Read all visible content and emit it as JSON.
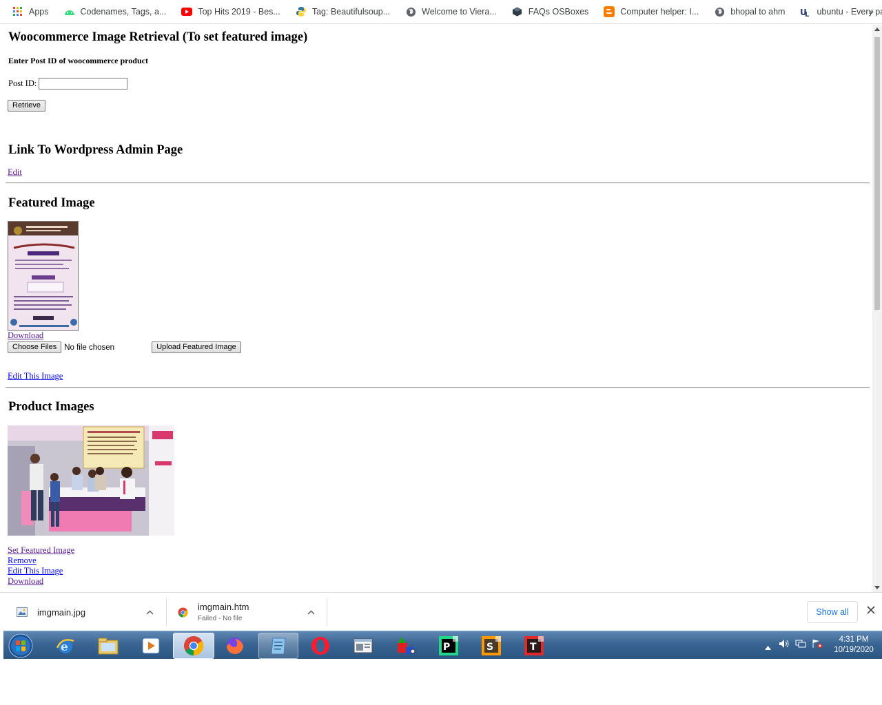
{
  "bookmarks": [
    {
      "label": "Apps",
      "icon": "apps-grid-icon"
    },
    {
      "label": "Codenames, Tags, a...",
      "icon": "android-icon"
    },
    {
      "label": "Top Hits 2019 - Bes...",
      "icon": "youtube-icon"
    },
    {
      "label": "Tag: Beautifulsoup...",
      "icon": "python-icon"
    },
    {
      "label": "Welcome to Viera...",
      "icon": "globe-icon"
    },
    {
      "label": "FAQs OSBoxes",
      "icon": "osboxes-cube-icon"
    },
    {
      "label": "Computer helper: I...",
      "icon": "blogger-icon"
    },
    {
      "label": "bhopal to ahm",
      "icon": "globe-icon"
    },
    {
      "label": "ubuntu - Every pac...",
      "icon": "unix-linux-icon"
    }
  ],
  "bookmarks_more": "»",
  "page": {
    "title": "Woocommerce Image Retrieval (To set featured image)",
    "enter_label": "Enter Post ID of woocommerce product",
    "post_id_label": "Post ID:",
    "post_id_value": "",
    "retrieve_button": "Retrieve",
    "admin_heading": "Link To Wordpress Admin Page",
    "edit_link": "Edit",
    "featured_heading": "Featured Image",
    "download_link": "Download",
    "choose_files_button": "Choose Files",
    "no_file_text": "No file chosen",
    "upload_button": "Upload Featured Image",
    "edit_image_link": "Edit This Image",
    "product_heading": "Product Images",
    "product_links": [
      "Set Featured Image",
      "Remove",
      "Edit This Image",
      "Download"
    ]
  },
  "downloads": {
    "items": [
      {
        "name": "imgmain.jpg",
        "status": ""
      },
      {
        "name": "imgmain.htm",
        "status": "Failed - No file"
      }
    ],
    "show_all": "Show all"
  },
  "taskbar": {
    "apps": [
      "start-orb-icon",
      "internet-explorer-icon",
      "file-explorer-icon",
      "media-player-icon",
      "chrome-icon",
      "firefox-icon",
      "notepad-icon",
      "opera-icon",
      "window-app-icon",
      "paint-shapes-icon",
      "pycharm-icon",
      "sublime-icon",
      "typora-icon"
    ],
    "time": "4:31 PM",
    "date": "10/19/2020"
  }
}
